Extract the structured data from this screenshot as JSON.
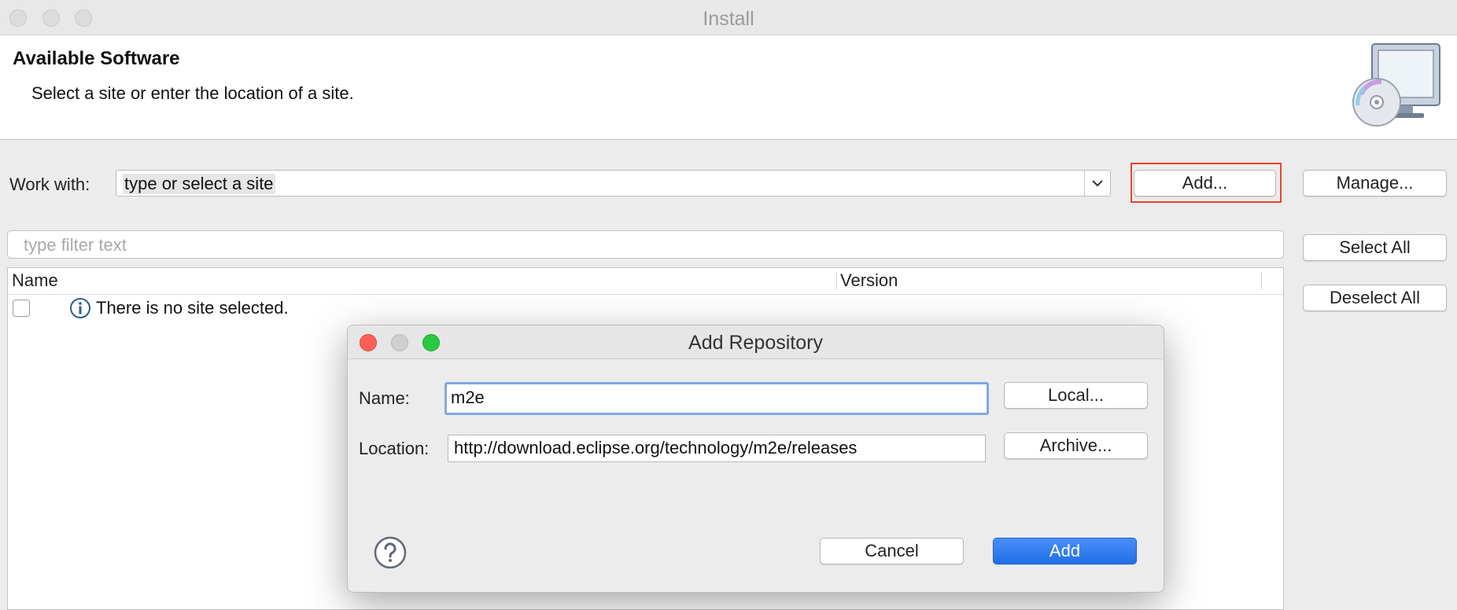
{
  "window": {
    "title": "Install"
  },
  "header": {
    "title": "Available Software",
    "subtitle": "Select a site or enter the location of a site.",
    "icon": "install-cd-monitor-icon"
  },
  "work_with": {
    "label": "Work with:",
    "value": "type or select a site",
    "add_label": "Add...",
    "manage_label": "Manage..."
  },
  "filter": {
    "placeholder": "type filter text"
  },
  "side_buttons": {
    "select_all": "Select All",
    "deselect_all": "Deselect All"
  },
  "table": {
    "columns": [
      "Name",
      "Version"
    ],
    "empty_message": "There is no site selected."
  },
  "dialog": {
    "title": "Add Repository",
    "name_label": "Name:",
    "name_value": "m2e",
    "location_label": "Location:",
    "location_value": "http://download.eclipse.org/technology/m2e/releases",
    "local_label": "Local...",
    "archive_label": "Archive...",
    "cancel_label": "Cancel",
    "add_label": "Add"
  },
  "colors": {
    "highlight": "#e8452b",
    "primary": "#1f6fe6",
    "close": "#fe5f57",
    "minimize": "#c8c8c8",
    "zoom": "#28c840"
  }
}
